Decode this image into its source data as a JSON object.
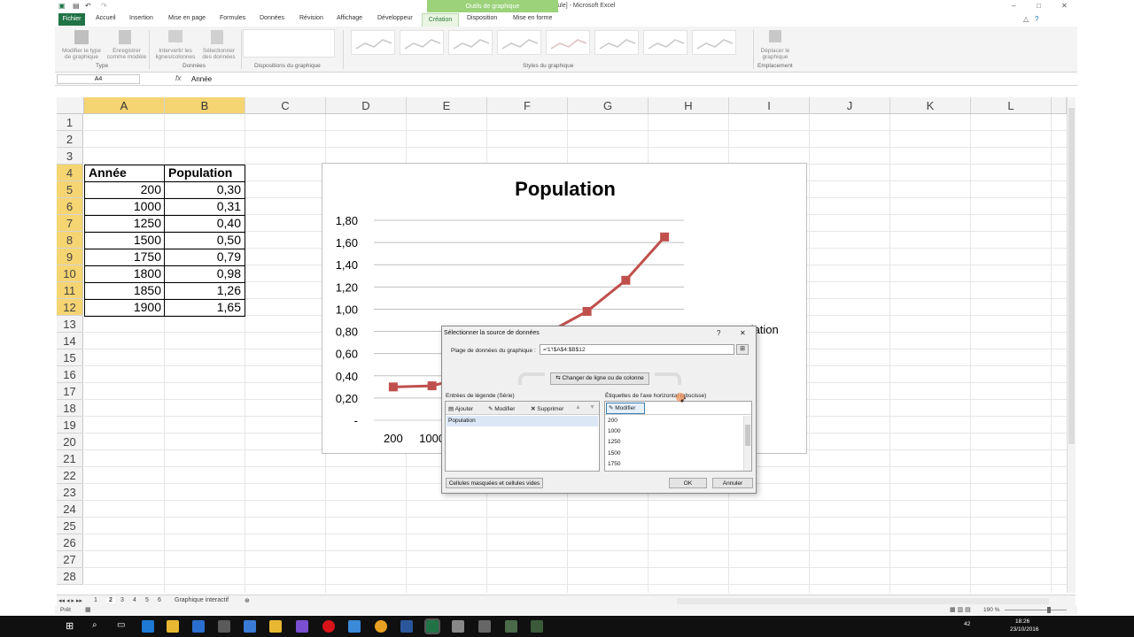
{
  "window": {
    "title": "Graphiques (étudiants)  [Lecture seule]  -  Microsoft Excel",
    "context_tab_group": "Outils de graphique"
  },
  "ribbon_tabs": [
    "Fichier",
    "Accueil",
    "Insertion",
    "Mise en page",
    "Formules",
    "Données",
    "Révision",
    "Affichage",
    "Développeur",
    "Création",
    "Disposition",
    "Mise en forme"
  ],
  "ribbon": {
    "change_type": "Modifier le type\nde graphique",
    "save_template": "Enregistrer\ncomme modèle",
    "group_type": "Type",
    "switch_rowcol": "Intervertir les\nlignes/colonnes",
    "select_data": "Sélectionner\ndes données",
    "group_data": "Données",
    "group_layouts": "Dispositions du graphique",
    "group_styles": "Styles du graphique",
    "move_chart": "Déplacer le\ngraphique",
    "group_location": "Emplacement"
  },
  "formula_bar": {
    "name_box": "A4",
    "fx": "fx",
    "content": "Année"
  },
  "columns": [
    "A",
    "B",
    "C",
    "D",
    "E",
    "F",
    "G",
    "H",
    "I",
    "J",
    "K",
    "L"
  ],
  "rows": [
    "1",
    "2",
    "3",
    "4",
    "5",
    "6",
    "7",
    "8",
    "9",
    "10",
    "11",
    "12",
    "13",
    "14",
    "15",
    "16",
    "17",
    "18",
    "19",
    "20",
    "21",
    "22",
    "23",
    "24",
    "25",
    "26",
    "27",
    "28"
  ],
  "table": {
    "headers": [
      "Année",
      "Population"
    ],
    "rows": [
      [
        "200",
        "0,30"
      ],
      [
        "1000",
        "0,31"
      ],
      [
        "1250",
        "0,40"
      ],
      [
        "1500",
        "0,50"
      ],
      [
        "1750",
        "0,79"
      ],
      [
        "1800",
        "0,98"
      ],
      [
        "1850",
        "1,26"
      ],
      [
        "1900",
        "1,65"
      ]
    ]
  },
  "chart_data": {
    "type": "line",
    "title": "Population",
    "categories": [
      "200",
      "1000",
      "1250",
      "1500",
      "1750",
      "1800",
      "1850",
      "1900"
    ],
    "series": [
      {
        "name": "Population",
        "values": [
          0.3,
          0.31,
          0.4,
          0.5,
          0.79,
          0.98,
          1.26,
          1.65
        ],
        "color": "#c0504d"
      }
    ],
    "y_ticks": [
      "-",
      "0,20",
      "0,40",
      "0,60",
      "0,80",
      "1,00",
      "1,20",
      "1,40",
      "1,60",
      "1,80"
    ],
    "x_tick_labels_visible": [
      "200",
      "1000"
    ],
    "legend_visible_text": "opulation",
    "ylim": [
      0,
      1.8
    ],
    "grid": true,
    "legend": "right"
  },
  "dialog": {
    "title": "Sélectionner la source de données",
    "help": "?",
    "close": "✕",
    "range_label": "Plage de données du graphique :",
    "range_value": "='1'!$A$4:$B$12",
    "switch_button": "Changer de ligne ou de colonne",
    "legend_label": "Entrées de légende (Série)",
    "add": "Ajouter",
    "edit": "Modifier",
    "remove": "Supprimer",
    "legend_items": [
      "Population"
    ],
    "axis_label": "Étiquettes de l'axe horizontal (abscisse)",
    "axis_edit": "Modifier",
    "axis_items": [
      "200",
      "1000",
      "1250",
      "1500",
      "1750"
    ],
    "hidden_cells": "Cellules masquées et cellules vides",
    "ok": "OK",
    "cancel": "Annuler"
  },
  "sheet_tabs": [
    "1",
    "2",
    "3",
    "4",
    "5",
    "6",
    "Graphique interactif"
  ],
  "status": {
    "ready": "Prêt",
    "zoom": "190 %"
  },
  "taskbar": {
    "time": "18:26",
    "date": "23/10/2016",
    "badge": "42"
  }
}
